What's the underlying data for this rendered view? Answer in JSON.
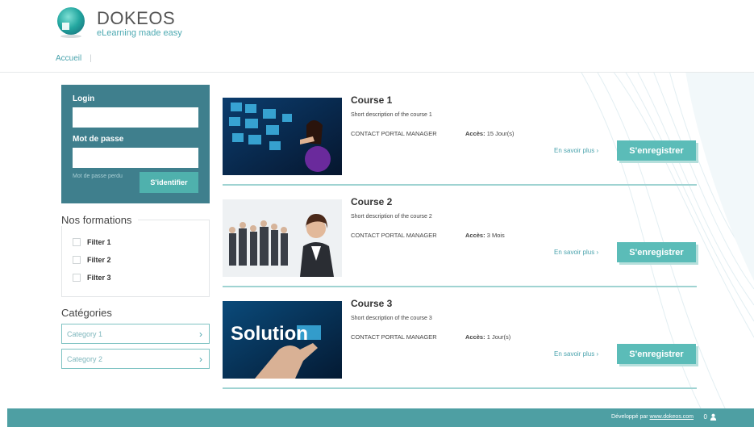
{
  "header": {
    "logo_name": "DOKEOS",
    "logo_tagline": "eLearning made easy",
    "nav": [
      {
        "label": "Accueil"
      }
    ],
    "nav_separator": "|"
  },
  "login": {
    "login_label": "Login",
    "login_value": "",
    "password_label": "Mot de passe",
    "password_value": "",
    "forgot_label": "Mot de passe perdu",
    "submit_label": "S'identifier"
  },
  "formations": {
    "title": "Nos formations",
    "filters": [
      {
        "label": "Filter 1",
        "checked": false
      },
      {
        "label": "Filter 2",
        "checked": false
      },
      {
        "label": "Filter 3",
        "checked": false
      }
    ]
  },
  "categories": {
    "title": "Catégories",
    "items": [
      {
        "label": "Category 1",
        "chevron": "›"
      },
      {
        "label": "Category 2",
        "chevron": "›"
      }
    ]
  },
  "courses": [
    {
      "title": "Course 1",
      "description": "Short description of the course 1",
      "contact": "CONTACT PORTAL MANAGER",
      "acces_label": "Accès:",
      "acces_value": "15 Jour(s)",
      "more_label": "En savoir plus ›",
      "register_label": "S'enregistrer"
    },
    {
      "title": "Course 2",
      "description": "Short description of the course 2",
      "contact": "CONTACT PORTAL MANAGER",
      "acces_label": "Accès:",
      "acces_value": "3 Mois",
      "more_label": "En savoir plus ›",
      "register_label": "S'enregistrer"
    },
    {
      "title": "Course 3",
      "description": "Short description of the course 3",
      "contact": "CONTACT PORTAL MANAGER",
      "acces_label": "Accès:",
      "acces_value": "1 Jour(s)",
      "more_label": "En savoir plus ›",
      "register_label": "S'enregistrer",
      "thumb_text": "Solution"
    }
  ],
  "footer": {
    "developed_by": "Développé par",
    "link": "www.dokeos.com",
    "online_count": "0"
  },
  "colors": {
    "accent": "#4aa3ad",
    "login_bg": "#3f7f8d",
    "button": "#5bbcb8",
    "footer": "#4e9fa3"
  }
}
